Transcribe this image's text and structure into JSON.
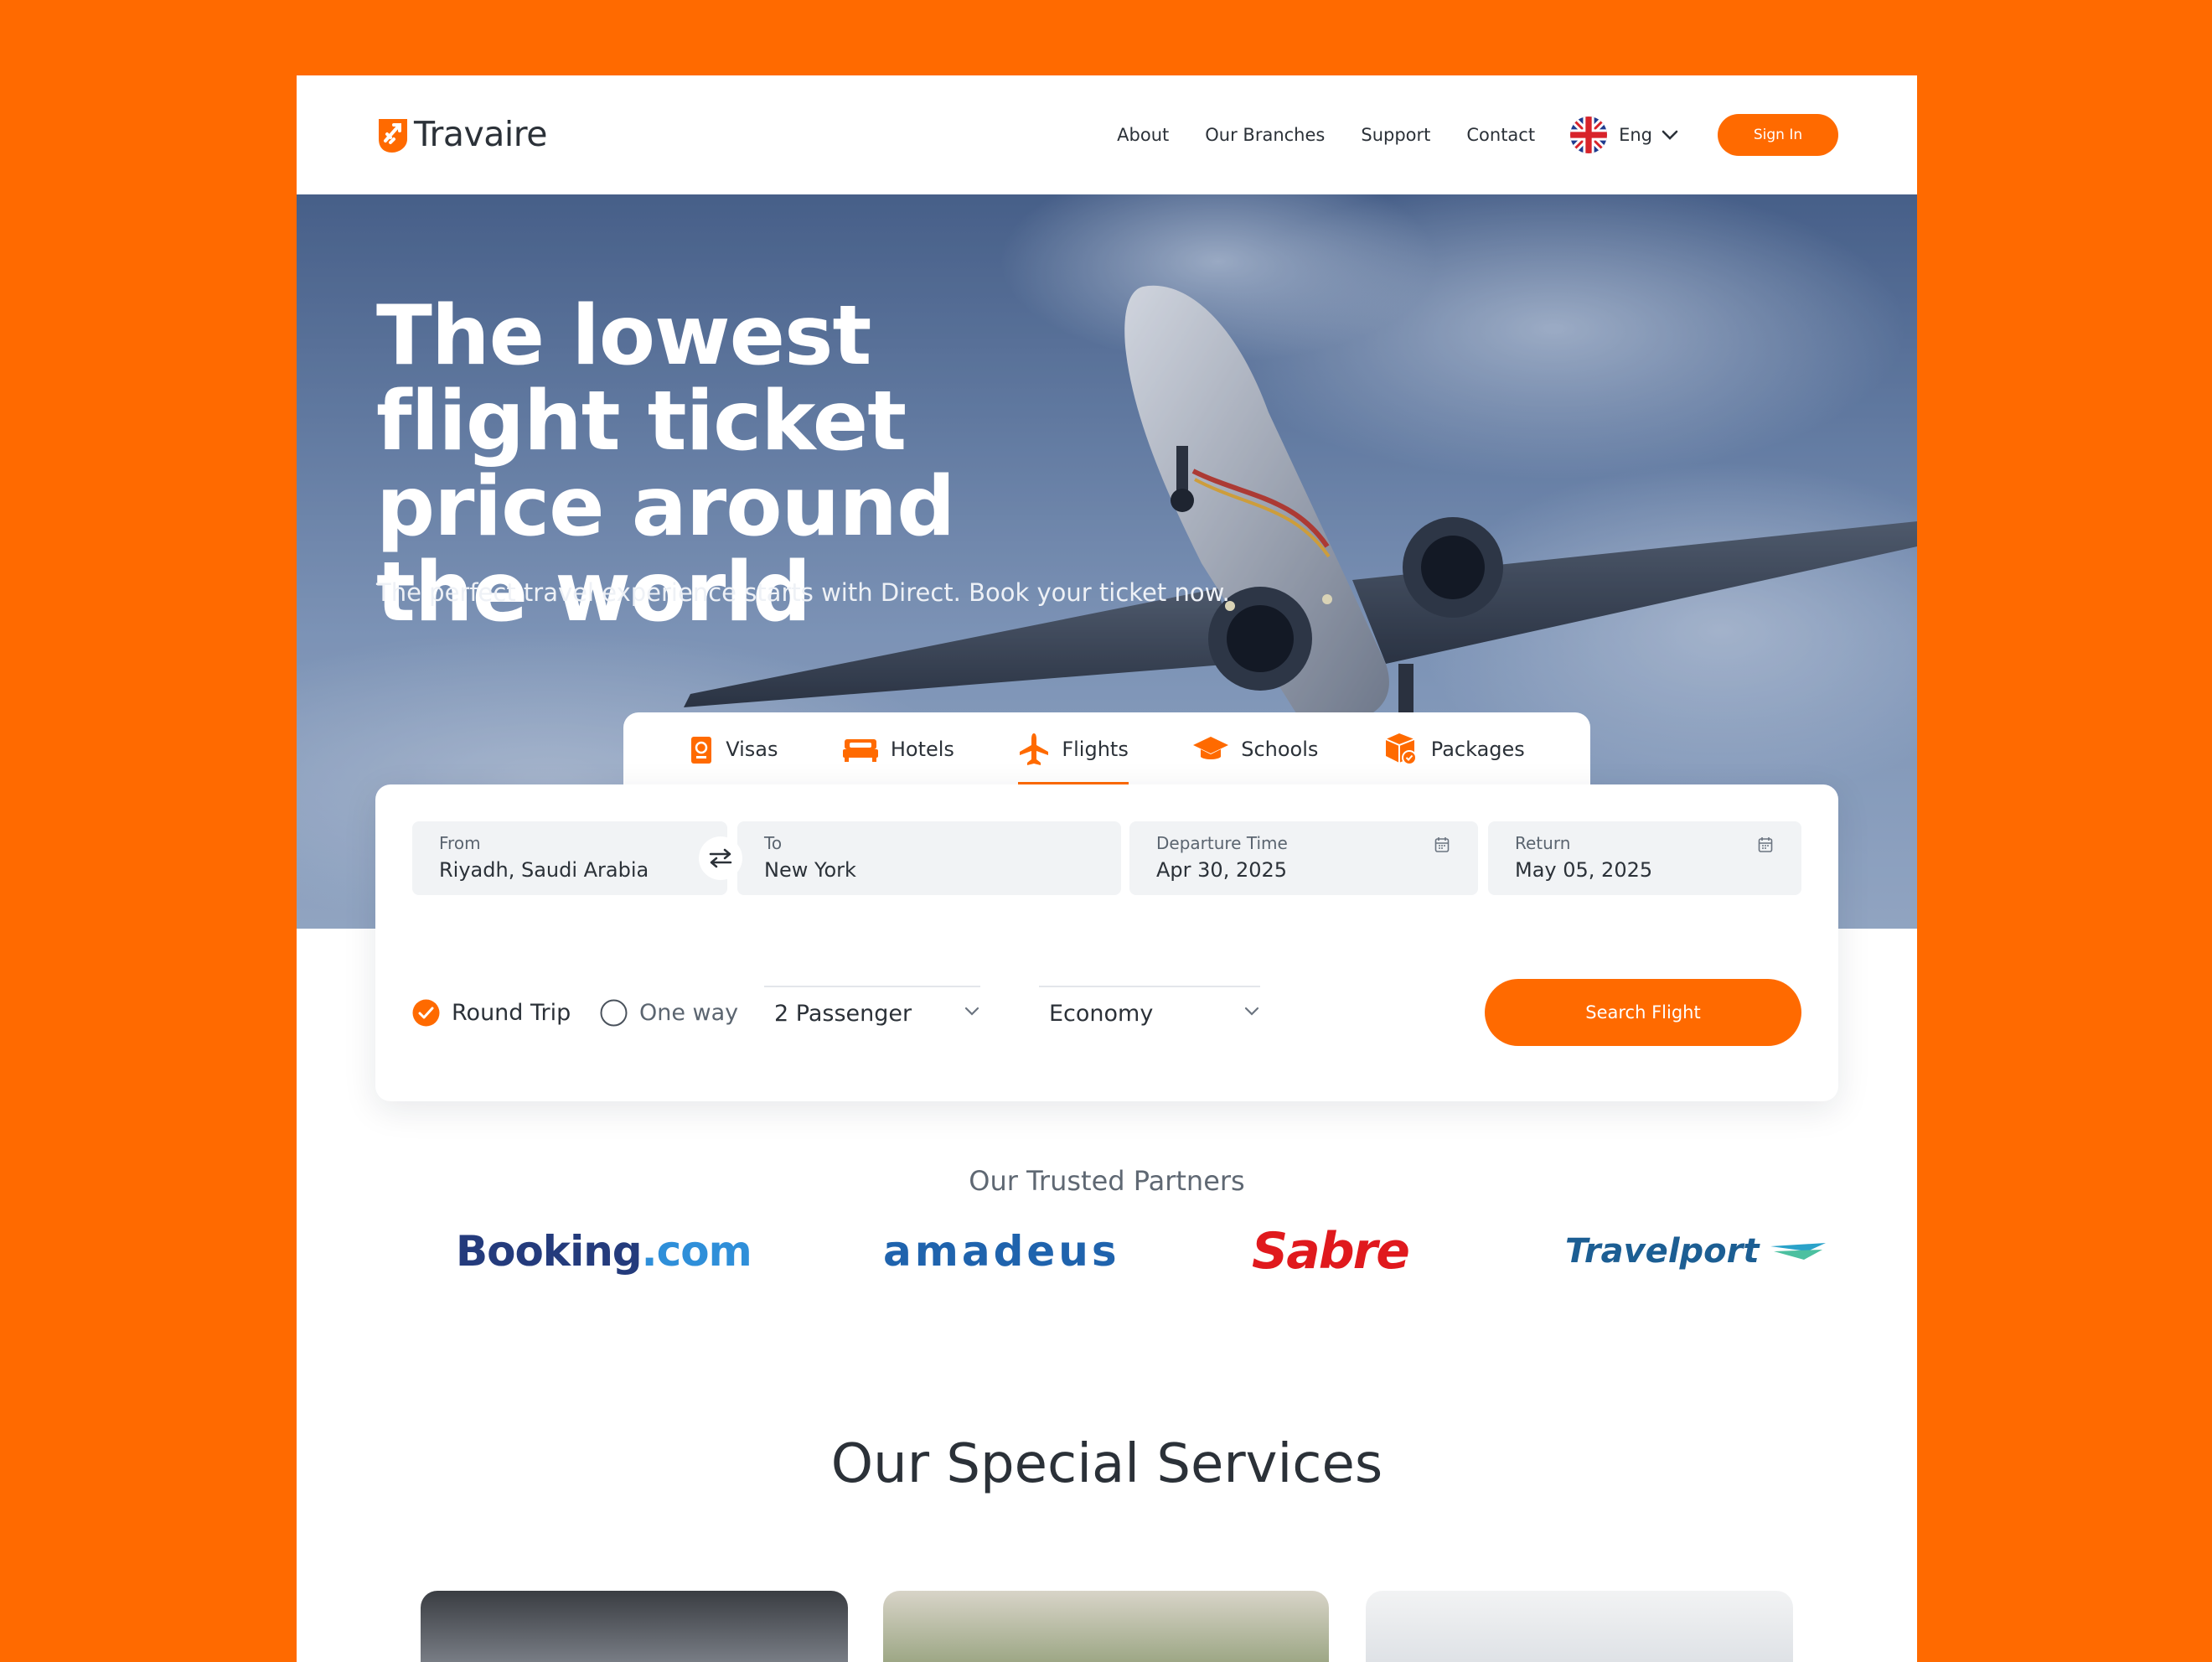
{
  "brand": {
    "name": "Travaire"
  },
  "nav": {
    "items": [
      "About",
      "Our Branches",
      "Support",
      "Contact"
    ],
    "language": "Eng",
    "sign_in": "Sign In"
  },
  "hero": {
    "title": "The lowest flight ticket price around the world",
    "subtitle": "The perfect travel experience starts with Direct. Book your ticket now."
  },
  "tabs": [
    {
      "label": "Visas",
      "icon": "passport-icon",
      "active": false
    },
    {
      "label": "Hotels",
      "icon": "bed-icon",
      "active": false
    },
    {
      "label": "Flights",
      "icon": "airplane-icon",
      "active": true
    },
    {
      "label": "Schools",
      "icon": "graduation-cap-icon",
      "active": false
    },
    {
      "label": "Packages",
      "icon": "package-icon",
      "active": false
    }
  ],
  "search": {
    "from": {
      "label": "From",
      "value": "Riyadh, Saudi Arabia"
    },
    "to": {
      "label": "To",
      "value": "New York"
    },
    "departure": {
      "label": "Departure Time",
      "value": "Apr 30, 2025"
    },
    "return": {
      "label": "Return",
      "value": "May 05, 2025"
    },
    "trip_types": [
      {
        "label": "Round Trip",
        "selected": true
      },
      {
        "label": "One way",
        "selected": false
      }
    ],
    "passengers": "2 Passenger",
    "cabin_class": "Economy",
    "submit": "Search Flight"
  },
  "partners": {
    "title": "Our Trusted Partners",
    "logos": [
      "Booking.com",
      "amadeus",
      "Sabre",
      "Travelport"
    ]
  },
  "services": {
    "title": "Our Special Services"
  },
  "colors": {
    "accent": "#ff6a00",
    "text": "#2b3138",
    "field_bg": "#f1f3f5"
  }
}
